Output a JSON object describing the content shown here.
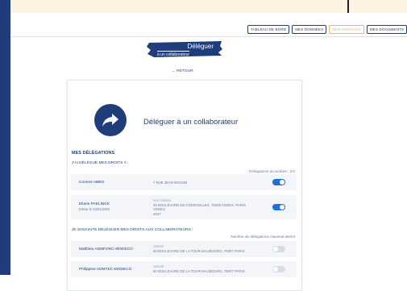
{
  "nav": {
    "tabs": [
      {
        "label": "TABLEAU DE BORD",
        "active": false
      },
      {
        "label": "MES DONNÉES",
        "active": false
      },
      {
        "label": "MES SERVICES",
        "active": true
      },
      {
        "label": "MES DOCUMENTS",
        "active": false
      }
    ]
  },
  "banner": {
    "title": "Déléguer",
    "subtitle": "à un collaborateur"
  },
  "back_label": "RETOUR",
  "card": {
    "title": "Déléguer à un collaborateur",
    "section_title": "MES DÉLÉGATIONS",
    "delegated_heading": "J'AI DÉLÉGUÉ MES DROITS À :",
    "delegations_count": "Délégations accordées : 2/2",
    "delegated_rows": [
      {
        "name": "Corinne ABBO",
        "date": "",
        "tag": "",
        "address": "7 RUE JEAN IRIGUIN",
        "enabled": true
      },
      {
        "name": "Eliane PAELINCK",
        "date": "Emise le 10/01/2022",
        "tag": "Non Salarié",
        "address": "25 BOULEVARD DE COURCELLES, 75008 CEDEX, PARIS CEDEX",
        "extra": "4947",
        "enabled": true
      }
    ],
    "wish_heading": "JE SOUHAITE DÉLÉGUER MES DROITS AUX COLLABORATEURS :",
    "max_reached": "Nombre de délégations maximal atteint",
    "wish_rows": [
      {
        "name": "Matthieu ADMFONC-MODECO",
        "tag": "Salarié",
        "address": "60 BOULEVARD DE LA TOUR-MAUBOURG, 75007 PARIS",
        "enabled": false
      },
      {
        "name": "Philippine ADMTEC-MODECO",
        "tag": "Salarié",
        "address": "60 BOULEVARD DE LA TOUR-MAUBOURG, 75007 PARIS",
        "enabled": false
      }
    ]
  },
  "colors": {
    "primary": "#1f3d7a",
    "accent": "#f0b763",
    "toggle_on": "#1e6fd6",
    "toggle_off": "#d7dbe3"
  }
}
